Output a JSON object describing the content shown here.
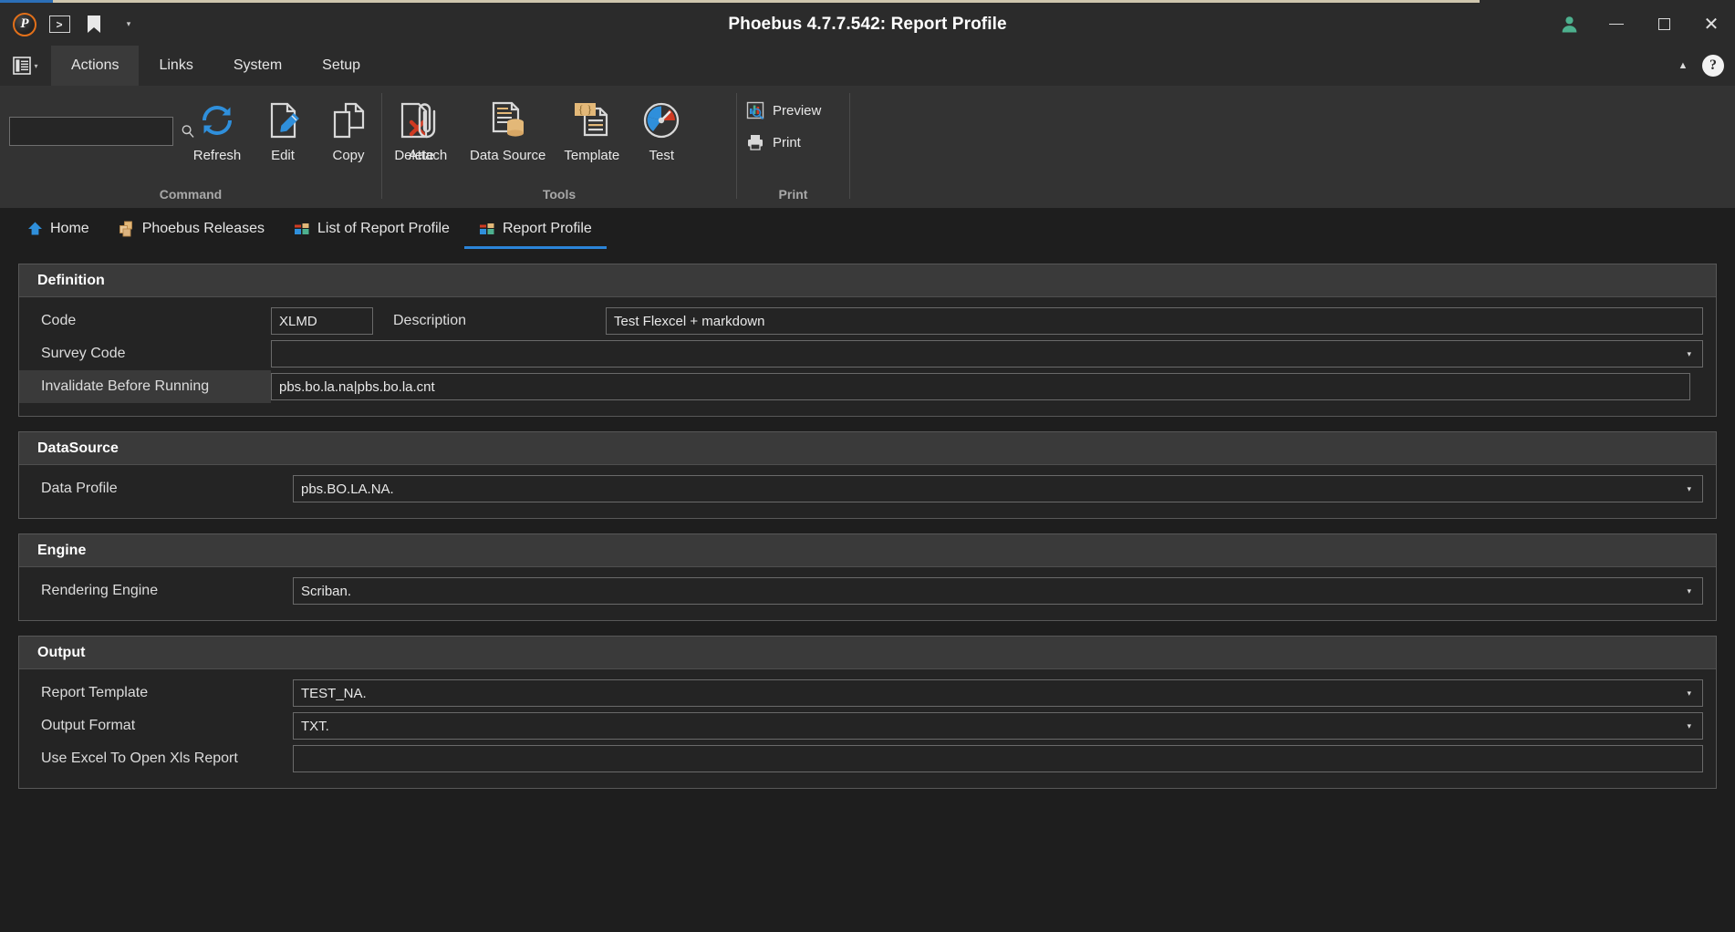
{
  "window": {
    "title": "Phoebus 4.7.7.542: Report Profile",
    "quick_access": [
      {
        "name": "phoebus-logo",
        "glyph": "P"
      },
      {
        "name": "console-icon",
        "glyph": ">"
      },
      {
        "name": "bookmark-icon",
        "glyph": "bookmark"
      },
      {
        "name": "qat-dropdown-icon",
        "glyph": "▾"
      }
    ],
    "controls": {
      "user": "user-icon",
      "minimize": "—",
      "maximize": "□",
      "close": "✕"
    }
  },
  "menubar": {
    "app_menu_icon": "application-menu-icon",
    "app_menu_caret": "▾",
    "tabs": [
      {
        "label": "Actions",
        "active": true
      },
      {
        "label": "Links",
        "active": false
      },
      {
        "label": "System",
        "active": false
      },
      {
        "label": "Setup",
        "active": false
      }
    ],
    "collapse_ribbon_icon": "▲",
    "help_icon": "?"
  },
  "ribbon": {
    "search": {
      "value": "",
      "placeholder": "",
      "icon": "search-icon"
    },
    "groups": [
      {
        "name": "Command",
        "label": "Command",
        "buttons": [
          {
            "label": "Refresh",
            "icon": "refresh-icon"
          },
          {
            "label": "Edit",
            "icon": "edit-icon"
          },
          {
            "label": "Copy",
            "icon": "copy-icon"
          },
          {
            "label": "Delete",
            "icon": "delete-icon"
          }
        ]
      },
      {
        "name": "Tools",
        "label": "Tools",
        "buttons": [
          {
            "label": "Attach",
            "icon": "attach-icon"
          },
          {
            "label": "Data Source",
            "icon": "data-source-icon"
          },
          {
            "label": "Template",
            "icon": "template-icon"
          },
          {
            "label": "Test",
            "icon": "test-icon"
          }
        ]
      },
      {
        "name": "Print",
        "label": "Print",
        "buttons": [
          {
            "label": "Preview",
            "icon": "preview-icon"
          },
          {
            "label": "Print",
            "icon": "print-icon"
          }
        ]
      }
    ]
  },
  "breadcrumbs": [
    {
      "label": "Home",
      "icon": "home-icon",
      "active": false
    },
    {
      "label": "Phoebus Releases",
      "icon": "releases-icon",
      "active": false
    },
    {
      "label": "List of Report Profile",
      "icon": "report-list-icon",
      "active": false
    },
    {
      "label": "Report Profile",
      "icon": "report-profile-icon",
      "active": true
    }
  ],
  "form": {
    "definition": {
      "title": "Definition",
      "code_label": "Code",
      "code_value": "XLMD",
      "description_label": "Description",
      "description_value": "Test Flexcel + markdown",
      "survey_code_label": "Survey Code",
      "survey_code_value": "",
      "invalidate_label": "Invalidate Before Running",
      "invalidate_value": "pbs.bo.la.na|pbs.bo.la.cnt"
    },
    "datasource": {
      "title": "DataSource",
      "data_profile_label": "Data Profile",
      "data_profile_value": "pbs.BO.LA.NA."
    },
    "engine": {
      "title": "Engine",
      "rendering_engine_label": "Rendering Engine",
      "rendering_engine_value": "Scriban."
    },
    "output": {
      "title": "Output",
      "report_template_label": "Report Template",
      "report_template_value": "TEST_NA.",
      "output_format_label": "Output Format",
      "output_format_value": "TXT.",
      "use_excel_label": "Use Excel To Open Xls Report",
      "use_excel_value": ""
    }
  },
  "colors": {
    "accent_blue": "#2b84d8",
    "ribbon_bg": "#333333",
    "panel_header": "#3a3a3a",
    "window_bg": "#1e1e1e",
    "title_bar": "#2b2b2b",
    "orange": "#e2701a",
    "tan": "#e3b878"
  },
  "dropdown_arrow": "▾"
}
